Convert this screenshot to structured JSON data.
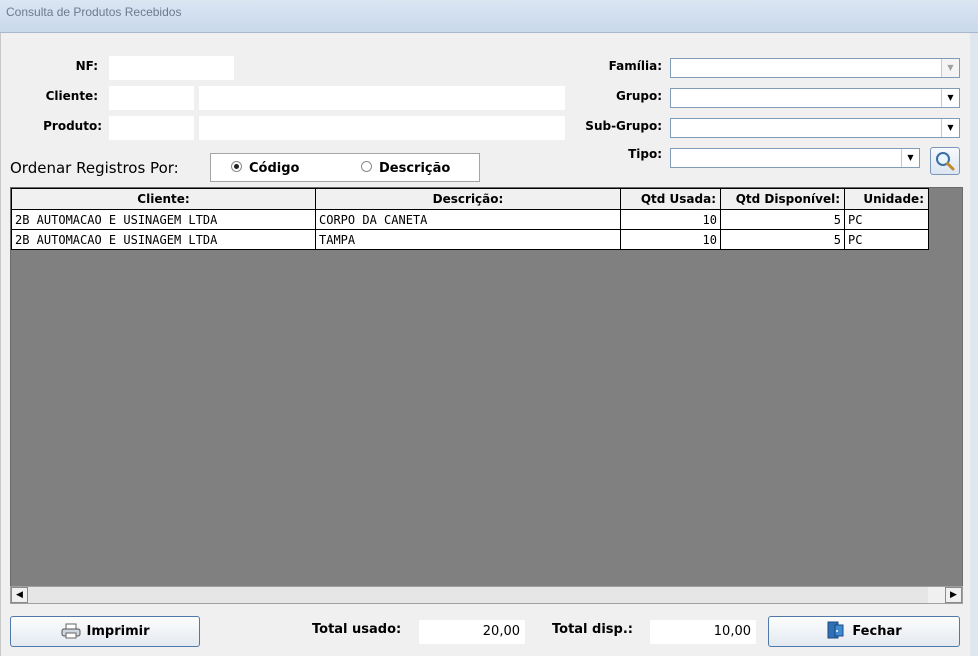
{
  "window": {
    "title": "Consulta de Produtos Recebidos"
  },
  "filters": {
    "nf_label": "NF:",
    "nf_value": "",
    "cliente_label": "Cliente:",
    "cliente_code": "",
    "cliente_name": "",
    "produto_label": "Produto:",
    "produto_code": "",
    "produto_name": "",
    "familia_label": "Família:",
    "familia_value": "",
    "grupo_label": "Grupo:",
    "grupo_value": "",
    "subgrupo_label": "Sub-Grupo:",
    "subgrupo_value": "",
    "tipo_label": "Tipo:",
    "tipo_value": ""
  },
  "order": {
    "label": "Ordenar Registros Por:",
    "options": [
      {
        "label": "Código",
        "selected": true
      },
      {
        "label": "Descrição",
        "selected": false
      }
    ]
  },
  "grid": {
    "columns": [
      "Cliente:",
      "Descrição:",
      "Qtd Usada:",
      "Qtd Disponível:",
      "Unidade:"
    ],
    "rows": [
      [
        "2B AUTOMACAO E USINAGEM LTDA",
        "CORPO DA CANETA",
        "10",
        "5",
        "PC"
      ],
      [
        "2B AUTOMACAO E USINAGEM LTDA",
        "TAMPA",
        "10",
        "5",
        "PC"
      ]
    ]
  },
  "footer": {
    "print_label": "Imprimir",
    "total_usado_label": "Total usado:",
    "total_usado_value": "20,00",
    "total_disp_label": "Total disp.:",
    "total_disp_value": "10,00",
    "close_label": "Fechar"
  },
  "colors": {
    "grid_bg": "#808080",
    "button_border": "#4f79a8"
  },
  "icons": {
    "search": "magnifier-icon",
    "print": "printer-icon",
    "close": "exit-door-icon"
  }
}
